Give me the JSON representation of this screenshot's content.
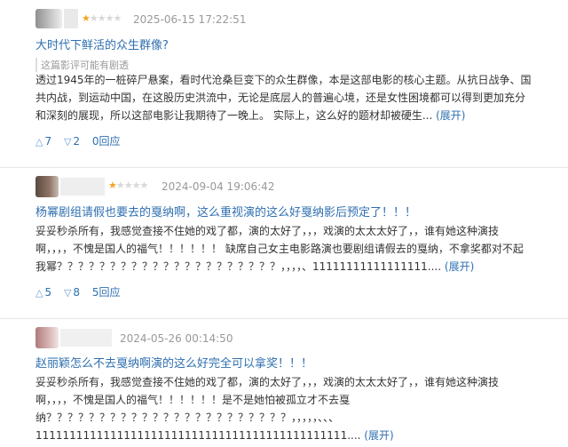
{
  "reviews": [
    {
      "stars_on": "★",
      "stars_off": "★★★★",
      "time": "2025-06-15 17:22:51",
      "title": "大时代下鲜活的众生群像?",
      "spoiler": "这篇影评可能有剧透",
      "body": "透过1945年的一桩碎尸悬案，看时代沧桑巨变下的众生群像，本是这部电影的核心主题。从抗日战争、国共内战，到运动中国，在这股历史洪流中，无论是底层人的普遍心境，还是女性困境都可以得到更加充分和深刻的展现，所以这部电影让我期待了一晚上。 实际上，这么好的题材却被硬生...",
      "expand": "(展开)",
      "up": "7",
      "down": "2",
      "replies": "0回应",
      "avatar_color": "#9a9a9a"
    },
    {
      "stars_on": "★",
      "stars_off": "★★★★",
      "time": "2024-09-04 19:06:42",
      "title": "杨幂剧组请假也要去的戛纳啊，这么重视演的这么好戛纳影后预定了！！！",
      "body": "妥妥秒杀所有，我感觉查接不住她的戏了都，演的太好了，，，戏演的太太太好了，，谁有她这种演技啊，，，，不愧是国人的福气！！！！！！ 缺席自己女主电影路演也要剧组请假去的戛纳，不拿奖都对不起我幂？？？？？？？？？？？？？？？？？？？？？，，，，、11111111111111111....",
      "expand": "(展开)",
      "up": "5",
      "down": "8",
      "replies": "5回应",
      "avatar_color": "#6e5a4e"
    },
    {
      "time": "2024-05-26 00:14:50",
      "title": "赵丽颖怎么不去戛纳啊演的这么好完全可以拿奖！！！",
      "body": "妥妥秒杀所有，我感觉查接不住她的戏了都，演的太好了，，，戏演的太太太好了，，谁有她这种演技啊，，，，不愧是国人的福气！！！！！！是不是她怕被孤立才不去戛纳？？？？？？？？？？？？？？？？？？？？？？？，，，，，、、、1111111111111111111111111111111111111111111111....",
      "expand": "(展开)",
      "avatar_color": "#c79a9a"
    }
  ],
  "colors": {
    "link": "#2f6fb0",
    "star_on": "#f5a623",
    "star_off": "#d8d8d8",
    "meta": "#999999"
  },
  "icons": {
    "up": "up-triangle-icon",
    "down": "down-triangle-icon"
  }
}
